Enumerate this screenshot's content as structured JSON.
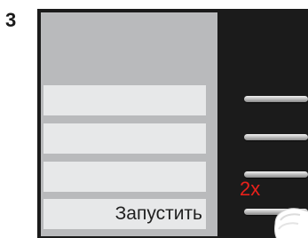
{
  "step": {
    "number": "3"
  },
  "menu": {
    "items": [
      {
        "label": ""
      },
      {
        "label": ""
      },
      {
        "label": ""
      },
      {
        "label": "Запустить"
      }
    ]
  },
  "instruction": {
    "press_count": "2x",
    "color": "#e8211b"
  },
  "icons": {
    "finger": "finger-press-icon"
  },
  "colors": {
    "device_body": "#1b1b1b",
    "screen_bg": "#b9babc",
    "menu_row_bg": "#e7e8e9"
  }
}
